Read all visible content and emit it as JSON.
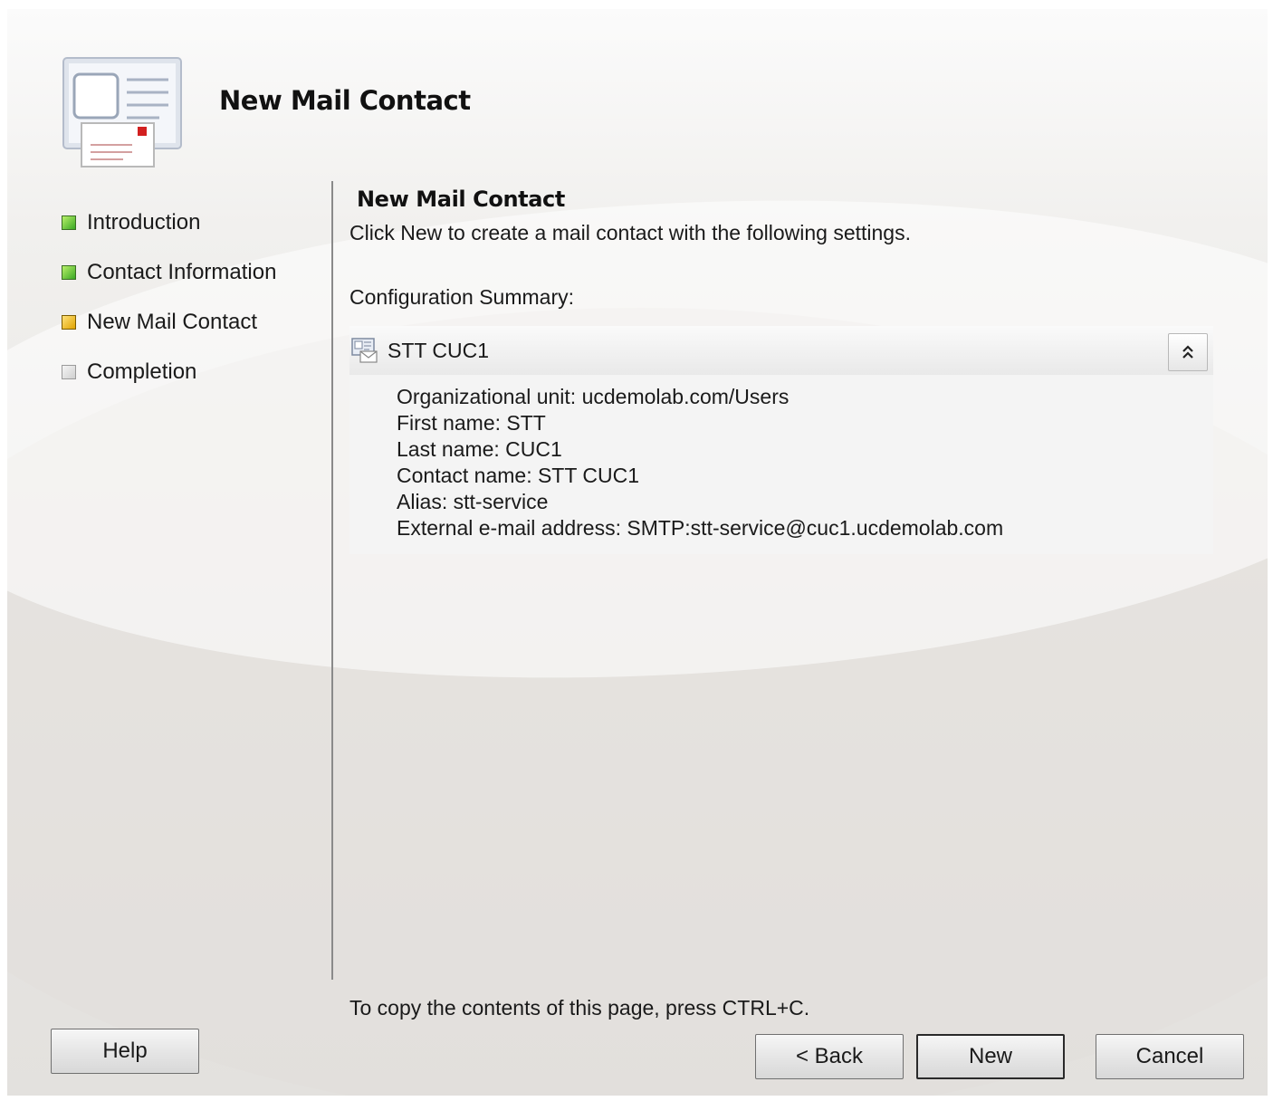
{
  "header": {
    "title": "New Mail Contact",
    "icon": "contact-card-icon"
  },
  "steps": [
    {
      "label": "Introduction",
      "state": "done"
    },
    {
      "label": "Contact Information",
      "state": "done"
    },
    {
      "label": "New Mail Contact",
      "state": "current"
    },
    {
      "label": "Completion",
      "state": "pending"
    }
  ],
  "content": {
    "title": "New Mail Contact",
    "description": "Click New to create a mail contact with the following settings.",
    "summary_label": "Configuration Summary:"
  },
  "summary": {
    "name": "STT CUC1",
    "collapse_symbol": "˄",
    "lines": [
      "Organizational unit: ucdemolab.com/Users",
      "First name: STT",
      "Last name: CUC1",
      "Contact name: STT CUC1",
      "Alias: stt-service",
      "External e-mail address: SMTP:stt-service@cuc1.ucdemolab.com"
    ]
  },
  "footer": {
    "copy_hint": "To copy the contents of this page, press CTRL+C.",
    "help_label": "Help",
    "back_label": "< Back",
    "new_label": "New",
    "cancel_label": "Cancel"
  },
  "colors": {
    "step_done": "#39a824",
    "step_current": "#e0a300",
    "step_pending": "#cfcfcf"
  }
}
